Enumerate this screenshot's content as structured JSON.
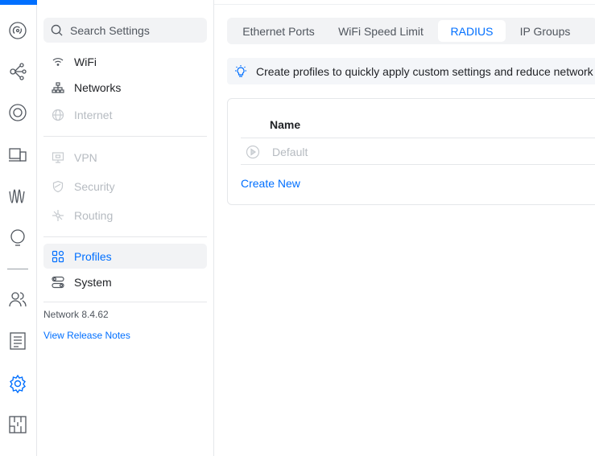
{
  "colors": {
    "accent": "#006fff",
    "disabled": "#b6bbc1",
    "text": "#212327"
  },
  "rail": {
    "icons": [
      "dashboard-icon",
      "topology-icon",
      "radar-icon",
      "devices-icon",
      "wifiman-icon",
      "insights-icon",
      "clients-icon",
      "logs-icon",
      "settings-icon",
      "floorplan-icon"
    ]
  },
  "sidebar": {
    "search_placeholder": "Search Settings",
    "items": [
      {
        "label": "WiFi",
        "icon": "wifi-icon",
        "state": "enabled"
      },
      {
        "label": "Networks",
        "icon": "network-tree-icon",
        "state": "enabled"
      },
      {
        "label": "Internet",
        "icon": "globe-icon",
        "state": "disabled"
      },
      {
        "label": "VPN",
        "icon": "vpn-monitor-icon",
        "state": "disabled"
      },
      {
        "label": "Security",
        "icon": "shield-icon",
        "state": "disabled"
      },
      {
        "label": "Routing",
        "icon": "routing-icon",
        "state": "disabled"
      },
      {
        "label": "Profiles",
        "icon": "profiles-grid-icon",
        "state": "active"
      },
      {
        "label": "System",
        "icon": "system-toggles-icon",
        "state": "enabled"
      }
    ],
    "version": "Network 8.4.62",
    "release_notes": "View Release Notes"
  },
  "main": {
    "tabs": [
      {
        "label": "Ethernet Ports",
        "active": false
      },
      {
        "label": "WiFi Speed Limit",
        "active": false
      },
      {
        "label": "RADIUS",
        "active": true
      },
      {
        "label": "IP Groups",
        "active": false
      }
    ],
    "banner": {
      "icon": "lightbulb-icon",
      "text": "Create profiles to quickly apply custom settings and reduce network"
    },
    "table": {
      "column_name": "Name",
      "rows": [
        {
          "name": "Default",
          "icon": "play-circle-icon"
        }
      ],
      "create_label": "Create New"
    }
  }
}
